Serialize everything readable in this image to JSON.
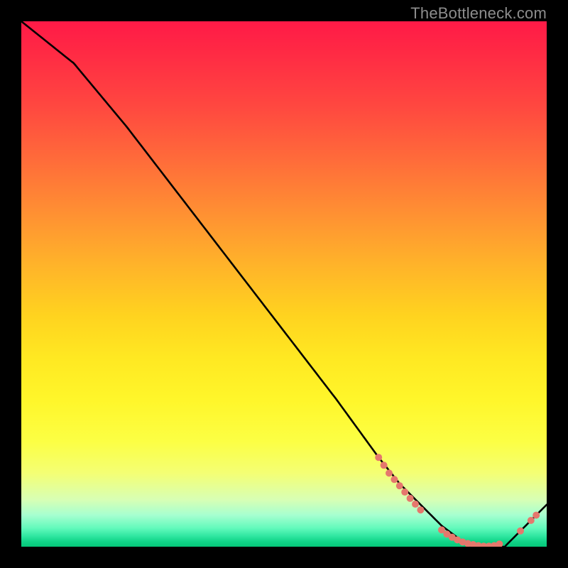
{
  "attribution": "TheBottleneck.com",
  "colors": {
    "marker": "#e5786d",
    "curve": "#000000",
    "background": "#000000"
  },
  "chart_data": {
    "type": "line",
    "title": "",
    "xlabel": "",
    "ylabel": "",
    "xlim": [
      0,
      100
    ],
    "ylim": [
      0,
      100
    ],
    "grid": false,
    "legend": false,
    "curve": {
      "comment": "Approximate bottleneck-vs-balance curve; descends from top-left, reaches near-zero trough around x≈82–90, rises slightly at right edge.",
      "x": [
        0,
        5,
        10,
        20,
        30,
        40,
        50,
        60,
        68,
        72,
        76,
        80,
        84,
        88,
        92,
        96,
        100
      ],
      "y": [
        100,
        96,
        92,
        80,
        67,
        54,
        41,
        28,
        17,
        12,
        8,
        4,
        1,
        0,
        0,
        4,
        8
      ]
    },
    "markers": {
      "comment": "Salmon dots clustered on the steep slope (~x 68–76) and along the trough (~x 80–95), with a pair near the right uptick.",
      "points": [
        {
          "x": 68,
          "y": 17
        },
        {
          "x": 69,
          "y": 15.5
        },
        {
          "x": 70,
          "y": 14
        },
        {
          "x": 71,
          "y": 12.8
        },
        {
          "x": 72,
          "y": 11.6
        },
        {
          "x": 73,
          "y": 10.4
        },
        {
          "x": 74,
          "y": 9.2
        },
        {
          "x": 75,
          "y": 8.1
        },
        {
          "x": 76,
          "y": 7.0
        },
        {
          "x": 80,
          "y": 3.2
        },
        {
          "x": 81,
          "y": 2.4
        },
        {
          "x": 82,
          "y": 1.8
        },
        {
          "x": 83,
          "y": 1.3
        },
        {
          "x": 84,
          "y": 0.9
        },
        {
          "x": 85,
          "y": 0.6
        },
        {
          "x": 86,
          "y": 0.4
        },
        {
          "x": 87,
          "y": 0.2
        },
        {
          "x": 88,
          "y": 0.1
        },
        {
          "x": 89,
          "y": 0.1
        },
        {
          "x": 90,
          "y": 0.2
        },
        {
          "x": 91,
          "y": 0.5
        },
        {
          "x": 95,
          "y": 3.0
        },
        {
          "x": 97,
          "y": 5.0
        },
        {
          "x": 98,
          "y": 6.0
        }
      ],
      "radius": 5
    }
  }
}
